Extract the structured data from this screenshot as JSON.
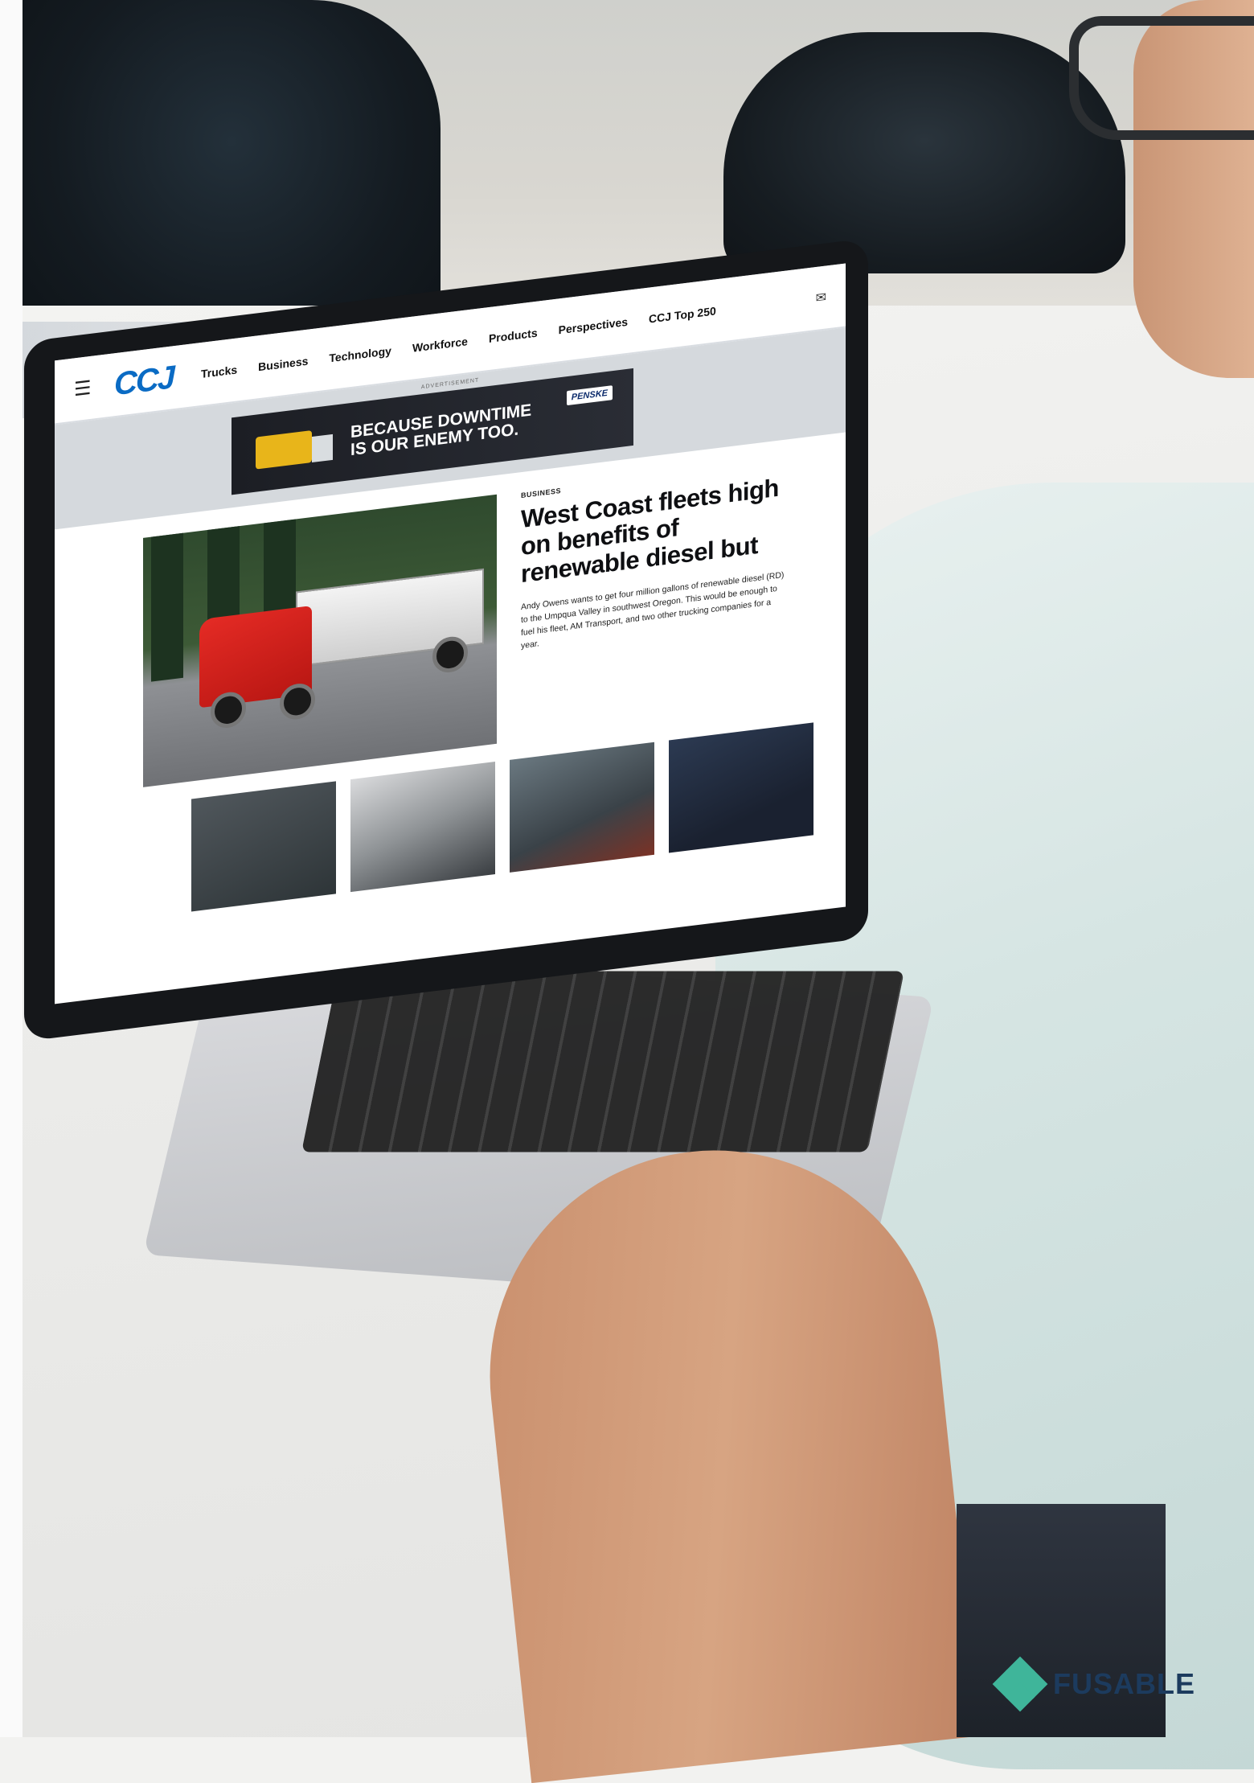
{
  "site": {
    "logo": "CCJ",
    "nav": [
      "Trucks",
      "Business",
      "Technology",
      "Workforce",
      "Products",
      "Perspectives",
      "CCJ Top 250"
    ],
    "menu_icon": "hamburger-icon",
    "mail_icon": "mail-icon"
  },
  "ad": {
    "label": "ADVERTISEMENT",
    "line1": "BECAUSE DOWNTIME",
    "line2": "IS OUR ENEMY TOO.",
    "brand": "PENSKE"
  },
  "article": {
    "kicker": "BUSINESS",
    "headline": "West Coast fleets high on benefits of renewable diesel but",
    "excerpt": "Andy Owens wants to get four million gallons of renewable diesel (RD) to the Umpqua Valley in southwest Oregon. This would be enough to fuel his fleet, AM Transport, and two other trucking companies for a year."
  },
  "watermark": {
    "brand": "FUSABLE",
    "color": "#3fb59a",
    "text_color": "#1c3b5e"
  }
}
